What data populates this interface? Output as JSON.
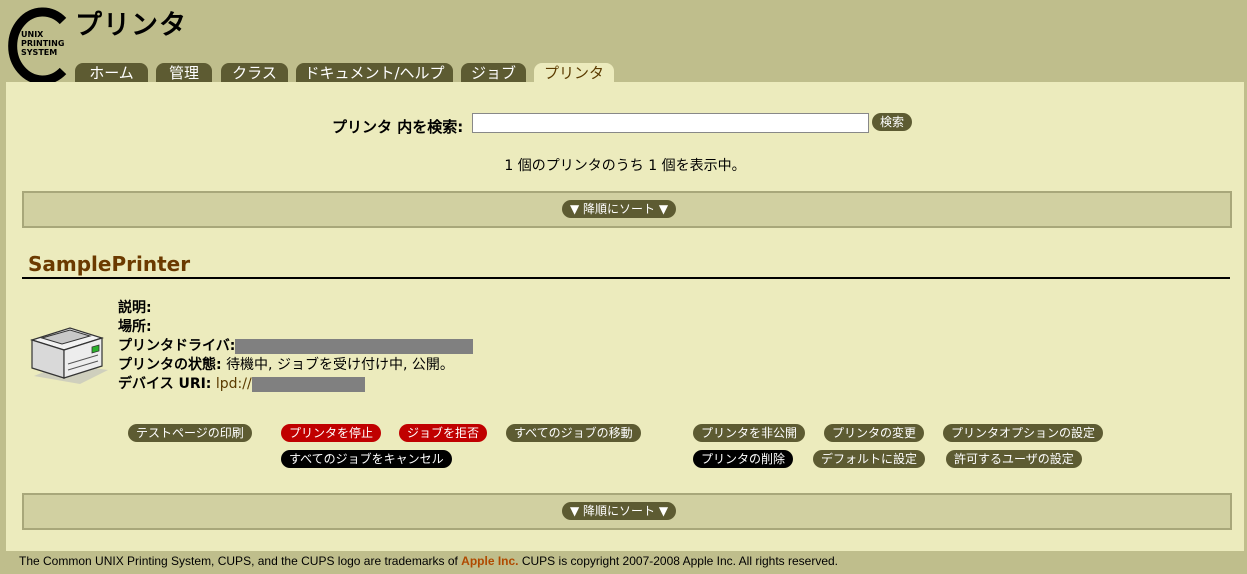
{
  "header": {
    "page_title": "プリンタ",
    "logo_text": [
      "UNIX",
      "PRINTING",
      "SYSTEM"
    ]
  },
  "tabs": [
    {
      "label": "ホーム",
      "active": false
    },
    {
      "label": "管理",
      "active": false
    },
    {
      "label": "クラス",
      "active": false
    },
    {
      "label": "ドキュメント/ヘルプ",
      "active": false
    },
    {
      "label": "ジョブ",
      "active": false
    },
    {
      "label": "プリンタ",
      "active": true
    }
  ],
  "search": {
    "label": "プリンタ 内を検索:",
    "value": "",
    "button_label": "検索"
  },
  "count_text": "1 個のプリンタのうち 1 個を表示中。",
  "sort": {
    "button_label": "▼ 降順にソート ▼"
  },
  "printer": {
    "name": "SamplePrinter",
    "description_label": "説明:",
    "description_value": "",
    "location_label": "場所:",
    "location_value": "",
    "driver_label": "プリンタドライバ:",
    "state_label": "プリンタの状態:",
    "state_value": "待機中, ジョブを受け付け中, 公開。",
    "uri_label": "デバイス URI:",
    "uri_value": "lpd://"
  },
  "actions": {
    "print_test_page": "テストページの印刷",
    "stop_printer": "プリンタを停止",
    "reject_jobs": "ジョブを拒否",
    "move_all_jobs": "すべてのジョブの移動",
    "cancel_all_jobs": "すべてのジョブをキャンセル",
    "unpublish_printer": "プリンタを非公開",
    "modify_printer": "プリンタの変更",
    "set_printer_options": "プリンタオプションの設定",
    "delete_printer": "プリンタの削除",
    "set_as_default": "デフォルトに設定",
    "set_allowed_users": "許可するユーザの設定"
  },
  "footer": {
    "text_before": "The Common UNIX Printing System, CUPS, and the CUPS logo are trademarks of ",
    "apple": "Apple Inc.",
    "text_after": " CUPS is copyright 2007-2008 Apple Inc. All rights reserved."
  },
  "colors": {
    "header_bg": "#bfbe8c",
    "content_bg": "#ecebbd",
    "button_bg": "#5d5b32",
    "danger_button_bg": "#c00000",
    "printer_name_color": "#6b3a00"
  }
}
